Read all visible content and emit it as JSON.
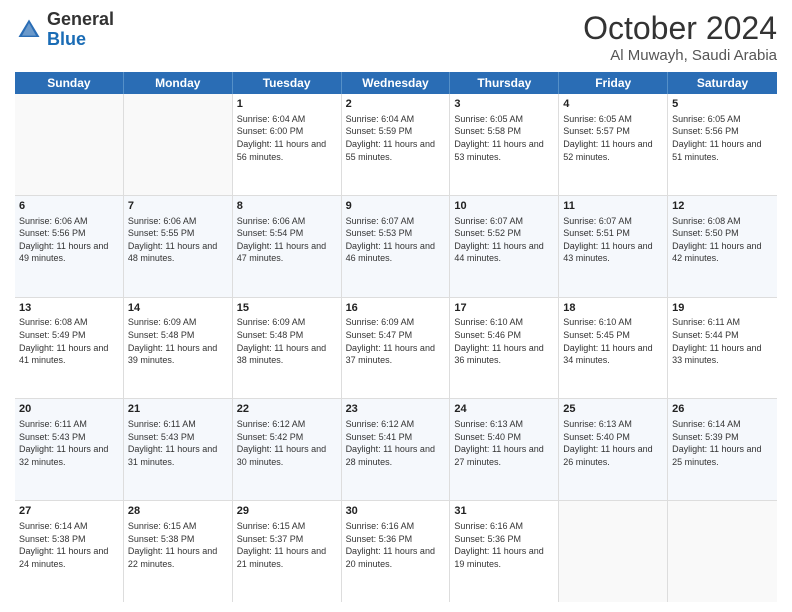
{
  "header": {
    "logo_general": "General",
    "logo_blue": "Blue",
    "month": "October 2024",
    "location": "Al Muwayh, Saudi Arabia"
  },
  "weekdays": [
    "Sunday",
    "Monday",
    "Tuesday",
    "Wednesday",
    "Thursday",
    "Friday",
    "Saturday"
  ],
  "rows": [
    {
      "cells": [
        {
          "day": "",
          "empty": true
        },
        {
          "day": "",
          "empty": true
        },
        {
          "day": "1",
          "sunrise": "6:04 AM",
          "sunset": "6:00 PM",
          "daylight": "11 hours and 56 minutes."
        },
        {
          "day": "2",
          "sunrise": "6:04 AM",
          "sunset": "5:59 PM",
          "daylight": "11 hours and 55 minutes."
        },
        {
          "day": "3",
          "sunrise": "6:05 AM",
          "sunset": "5:58 PM",
          "daylight": "11 hours and 53 minutes."
        },
        {
          "day": "4",
          "sunrise": "6:05 AM",
          "sunset": "5:57 PM",
          "daylight": "11 hours and 52 minutes."
        },
        {
          "day": "5",
          "sunrise": "6:05 AM",
          "sunset": "5:56 PM",
          "daylight": "11 hours and 51 minutes."
        }
      ]
    },
    {
      "cells": [
        {
          "day": "6",
          "sunrise": "6:06 AM",
          "sunset": "5:56 PM",
          "daylight": "11 hours and 49 minutes."
        },
        {
          "day": "7",
          "sunrise": "6:06 AM",
          "sunset": "5:55 PM",
          "daylight": "11 hours and 48 minutes."
        },
        {
          "day": "8",
          "sunrise": "6:06 AM",
          "sunset": "5:54 PM",
          "daylight": "11 hours and 47 minutes."
        },
        {
          "day": "9",
          "sunrise": "6:07 AM",
          "sunset": "5:53 PM",
          "daylight": "11 hours and 46 minutes."
        },
        {
          "day": "10",
          "sunrise": "6:07 AM",
          "sunset": "5:52 PM",
          "daylight": "11 hours and 44 minutes."
        },
        {
          "day": "11",
          "sunrise": "6:07 AM",
          "sunset": "5:51 PM",
          "daylight": "11 hours and 43 minutes."
        },
        {
          "day": "12",
          "sunrise": "6:08 AM",
          "sunset": "5:50 PM",
          "daylight": "11 hours and 42 minutes."
        }
      ]
    },
    {
      "cells": [
        {
          "day": "13",
          "sunrise": "6:08 AM",
          "sunset": "5:49 PM",
          "daylight": "11 hours and 41 minutes."
        },
        {
          "day": "14",
          "sunrise": "6:09 AM",
          "sunset": "5:48 PM",
          "daylight": "11 hours and 39 minutes."
        },
        {
          "day": "15",
          "sunrise": "6:09 AM",
          "sunset": "5:48 PM",
          "daylight": "11 hours and 38 minutes."
        },
        {
          "day": "16",
          "sunrise": "6:09 AM",
          "sunset": "5:47 PM",
          "daylight": "11 hours and 37 minutes."
        },
        {
          "day": "17",
          "sunrise": "6:10 AM",
          "sunset": "5:46 PM",
          "daylight": "11 hours and 36 minutes."
        },
        {
          "day": "18",
          "sunrise": "6:10 AM",
          "sunset": "5:45 PM",
          "daylight": "11 hours and 34 minutes."
        },
        {
          "day": "19",
          "sunrise": "6:11 AM",
          "sunset": "5:44 PM",
          "daylight": "11 hours and 33 minutes."
        }
      ]
    },
    {
      "cells": [
        {
          "day": "20",
          "sunrise": "6:11 AM",
          "sunset": "5:43 PM",
          "daylight": "11 hours and 32 minutes."
        },
        {
          "day": "21",
          "sunrise": "6:11 AM",
          "sunset": "5:43 PM",
          "daylight": "11 hours and 31 minutes."
        },
        {
          "day": "22",
          "sunrise": "6:12 AM",
          "sunset": "5:42 PM",
          "daylight": "11 hours and 30 minutes."
        },
        {
          "day": "23",
          "sunrise": "6:12 AM",
          "sunset": "5:41 PM",
          "daylight": "11 hours and 28 minutes."
        },
        {
          "day": "24",
          "sunrise": "6:13 AM",
          "sunset": "5:40 PM",
          "daylight": "11 hours and 27 minutes."
        },
        {
          "day": "25",
          "sunrise": "6:13 AM",
          "sunset": "5:40 PM",
          "daylight": "11 hours and 26 minutes."
        },
        {
          "day": "26",
          "sunrise": "6:14 AM",
          "sunset": "5:39 PM",
          "daylight": "11 hours and 25 minutes."
        }
      ]
    },
    {
      "cells": [
        {
          "day": "27",
          "sunrise": "6:14 AM",
          "sunset": "5:38 PM",
          "daylight": "11 hours and 24 minutes."
        },
        {
          "day": "28",
          "sunrise": "6:15 AM",
          "sunset": "5:38 PM",
          "daylight": "11 hours and 22 minutes."
        },
        {
          "day": "29",
          "sunrise": "6:15 AM",
          "sunset": "5:37 PM",
          "daylight": "11 hours and 21 minutes."
        },
        {
          "day": "30",
          "sunrise": "6:16 AM",
          "sunset": "5:36 PM",
          "daylight": "11 hours and 20 minutes."
        },
        {
          "day": "31",
          "sunrise": "6:16 AM",
          "sunset": "5:36 PM",
          "daylight": "11 hours and 19 minutes."
        },
        {
          "day": "",
          "empty": true
        },
        {
          "day": "",
          "empty": true
        }
      ]
    }
  ]
}
